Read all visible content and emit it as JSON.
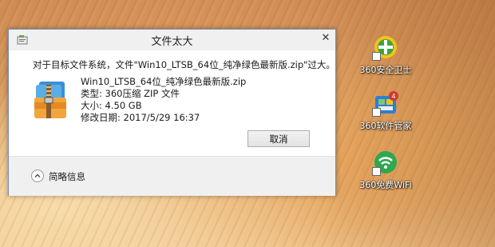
{
  "dialog": {
    "title": "文件太大",
    "close_glyph": "✕",
    "message": "对于目标文件系统，文件\"Win10_LTSB_64位_纯净绿色最新版.zip\"过大。",
    "file": {
      "name": "Win10_LTSB_64位_纯净绿色最新版.zip",
      "type": "类型: 360压缩 ZIP 文件",
      "size": "大小: 4.50 GB",
      "modified": "修改日期: 2017/5/29 16:37"
    },
    "cancel_label": "取消",
    "details_label": "简略信息"
  },
  "desktop": {
    "icons": [
      {
        "label": "360安全卫士",
        "icon": "360-safe-icon",
        "color": "#3aa63a"
      },
      {
        "label": "360软件管家",
        "icon": "360-software-manager-icon",
        "color": "#d0392b"
      },
      {
        "label": "360免费WiFi",
        "icon": "360-free-wifi-icon",
        "color": "#2fa84f"
      }
    ]
  }
}
